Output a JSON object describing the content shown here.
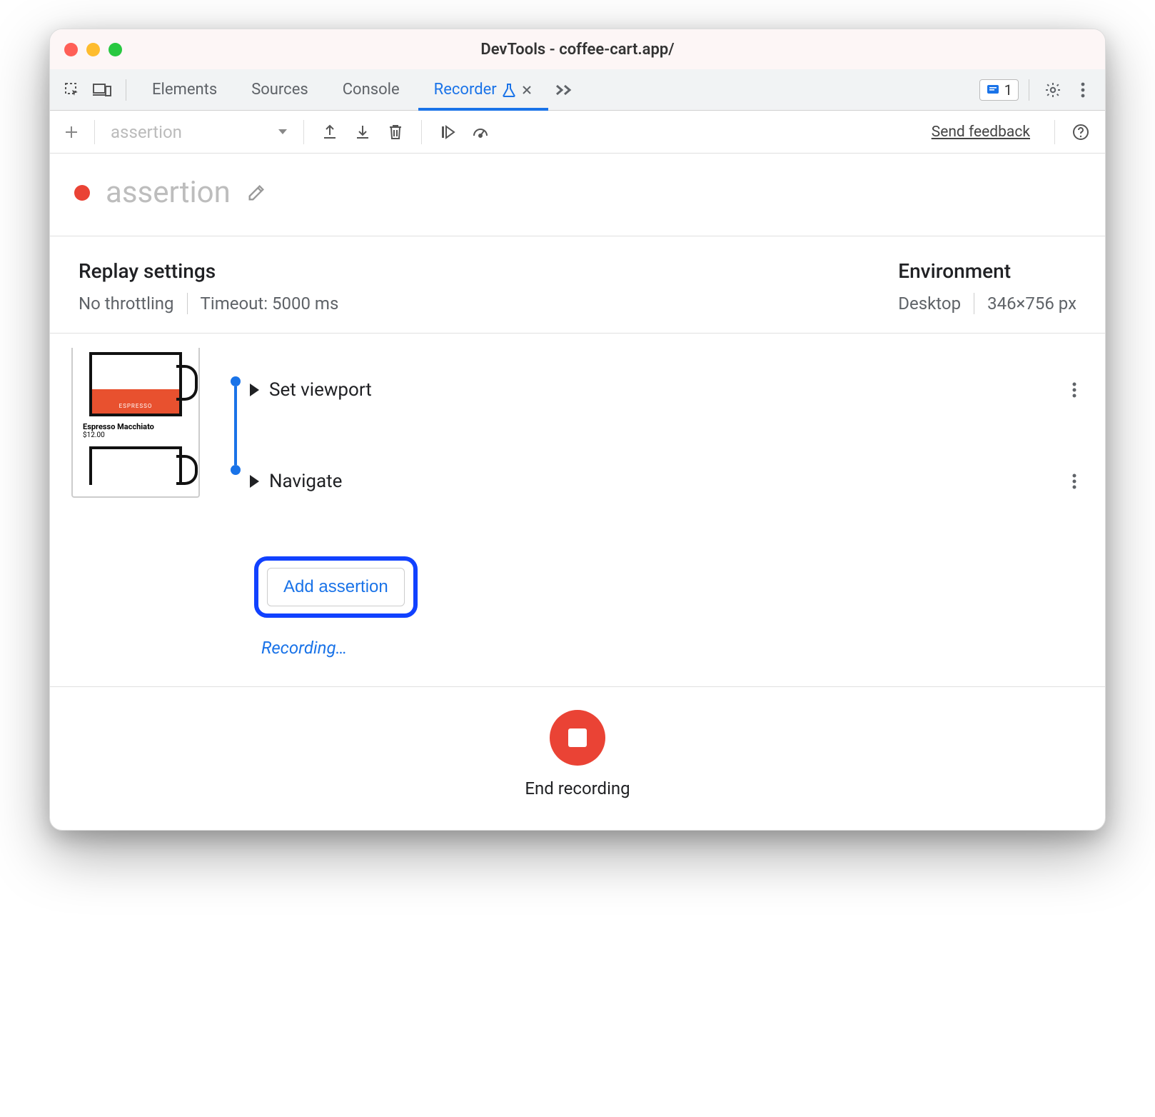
{
  "window": {
    "title": "DevTools - coffee-cart.app/"
  },
  "tabs": {
    "items": [
      "Elements",
      "Sources",
      "Console",
      "Recorder"
    ],
    "active": "Recorder",
    "issues_count": "1"
  },
  "toolbar": {
    "dropdown_value": "assertion",
    "feedback": "Send feedback"
  },
  "recording": {
    "name": "assertion"
  },
  "replay_settings": {
    "heading": "Replay settings",
    "throttling": "No throttling",
    "timeout": "Timeout: 5000 ms"
  },
  "environment": {
    "heading": "Environment",
    "device": "Desktop",
    "viewport": "346×756 px"
  },
  "thumb": {
    "caption": "Espresso Macchiato",
    "price": "$12.00",
    "cup_label": "ESPRESSO"
  },
  "steps": {
    "items": [
      {
        "label": "Set viewport"
      },
      {
        "label": "Navigate"
      }
    ],
    "add_button": "Add assertion",
    "status": "Recording…"
  },
  "footer": {
    "end_label": "End recording"
  }
}
